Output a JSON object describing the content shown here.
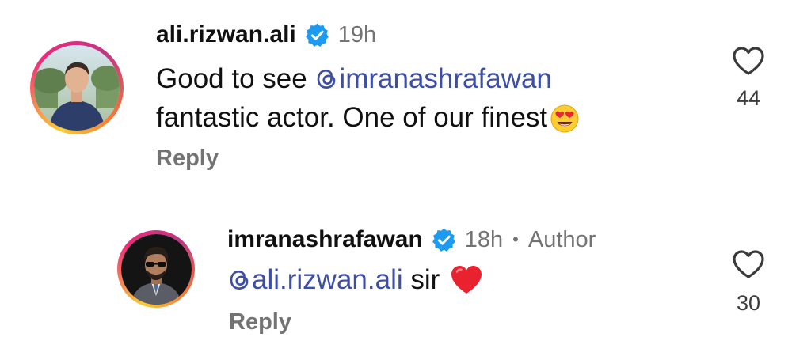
{
  "comments": [
    {
      "username": "ali.rizwan.ali",
      "time": "19h",
      "text_prefix": "Good to see ",
      "mention": "imranashrafawan",
      "text_line2": "fantastic actor. One of our finest",
      "reply_label": "Reply",
      "like_count": "44"
    },
    {
      "username": "imranashrafawan",
      "time": "18h",
      "separator": "•",
      "author_label": "Author",
      "mention": "ali.rizwan.ali",
      "text_suffix": " sir",
      "reply_label": "Reply",
      "like_count": "30"
    }
  ],
  "icons": {
    "verified": "verified-badge-icon",
    "mention": "threads-at-icon",
    "like": "heart-outline-icon",
    "emoji_1": "heart-eyes-emoji",
    "emoji_2": "red-heart-emoji"
  },
  "colors": {
    "mention": "#3d4ea6",
    "verified": "#1d9bf0",
    "muted": "#737373"
  }
}
